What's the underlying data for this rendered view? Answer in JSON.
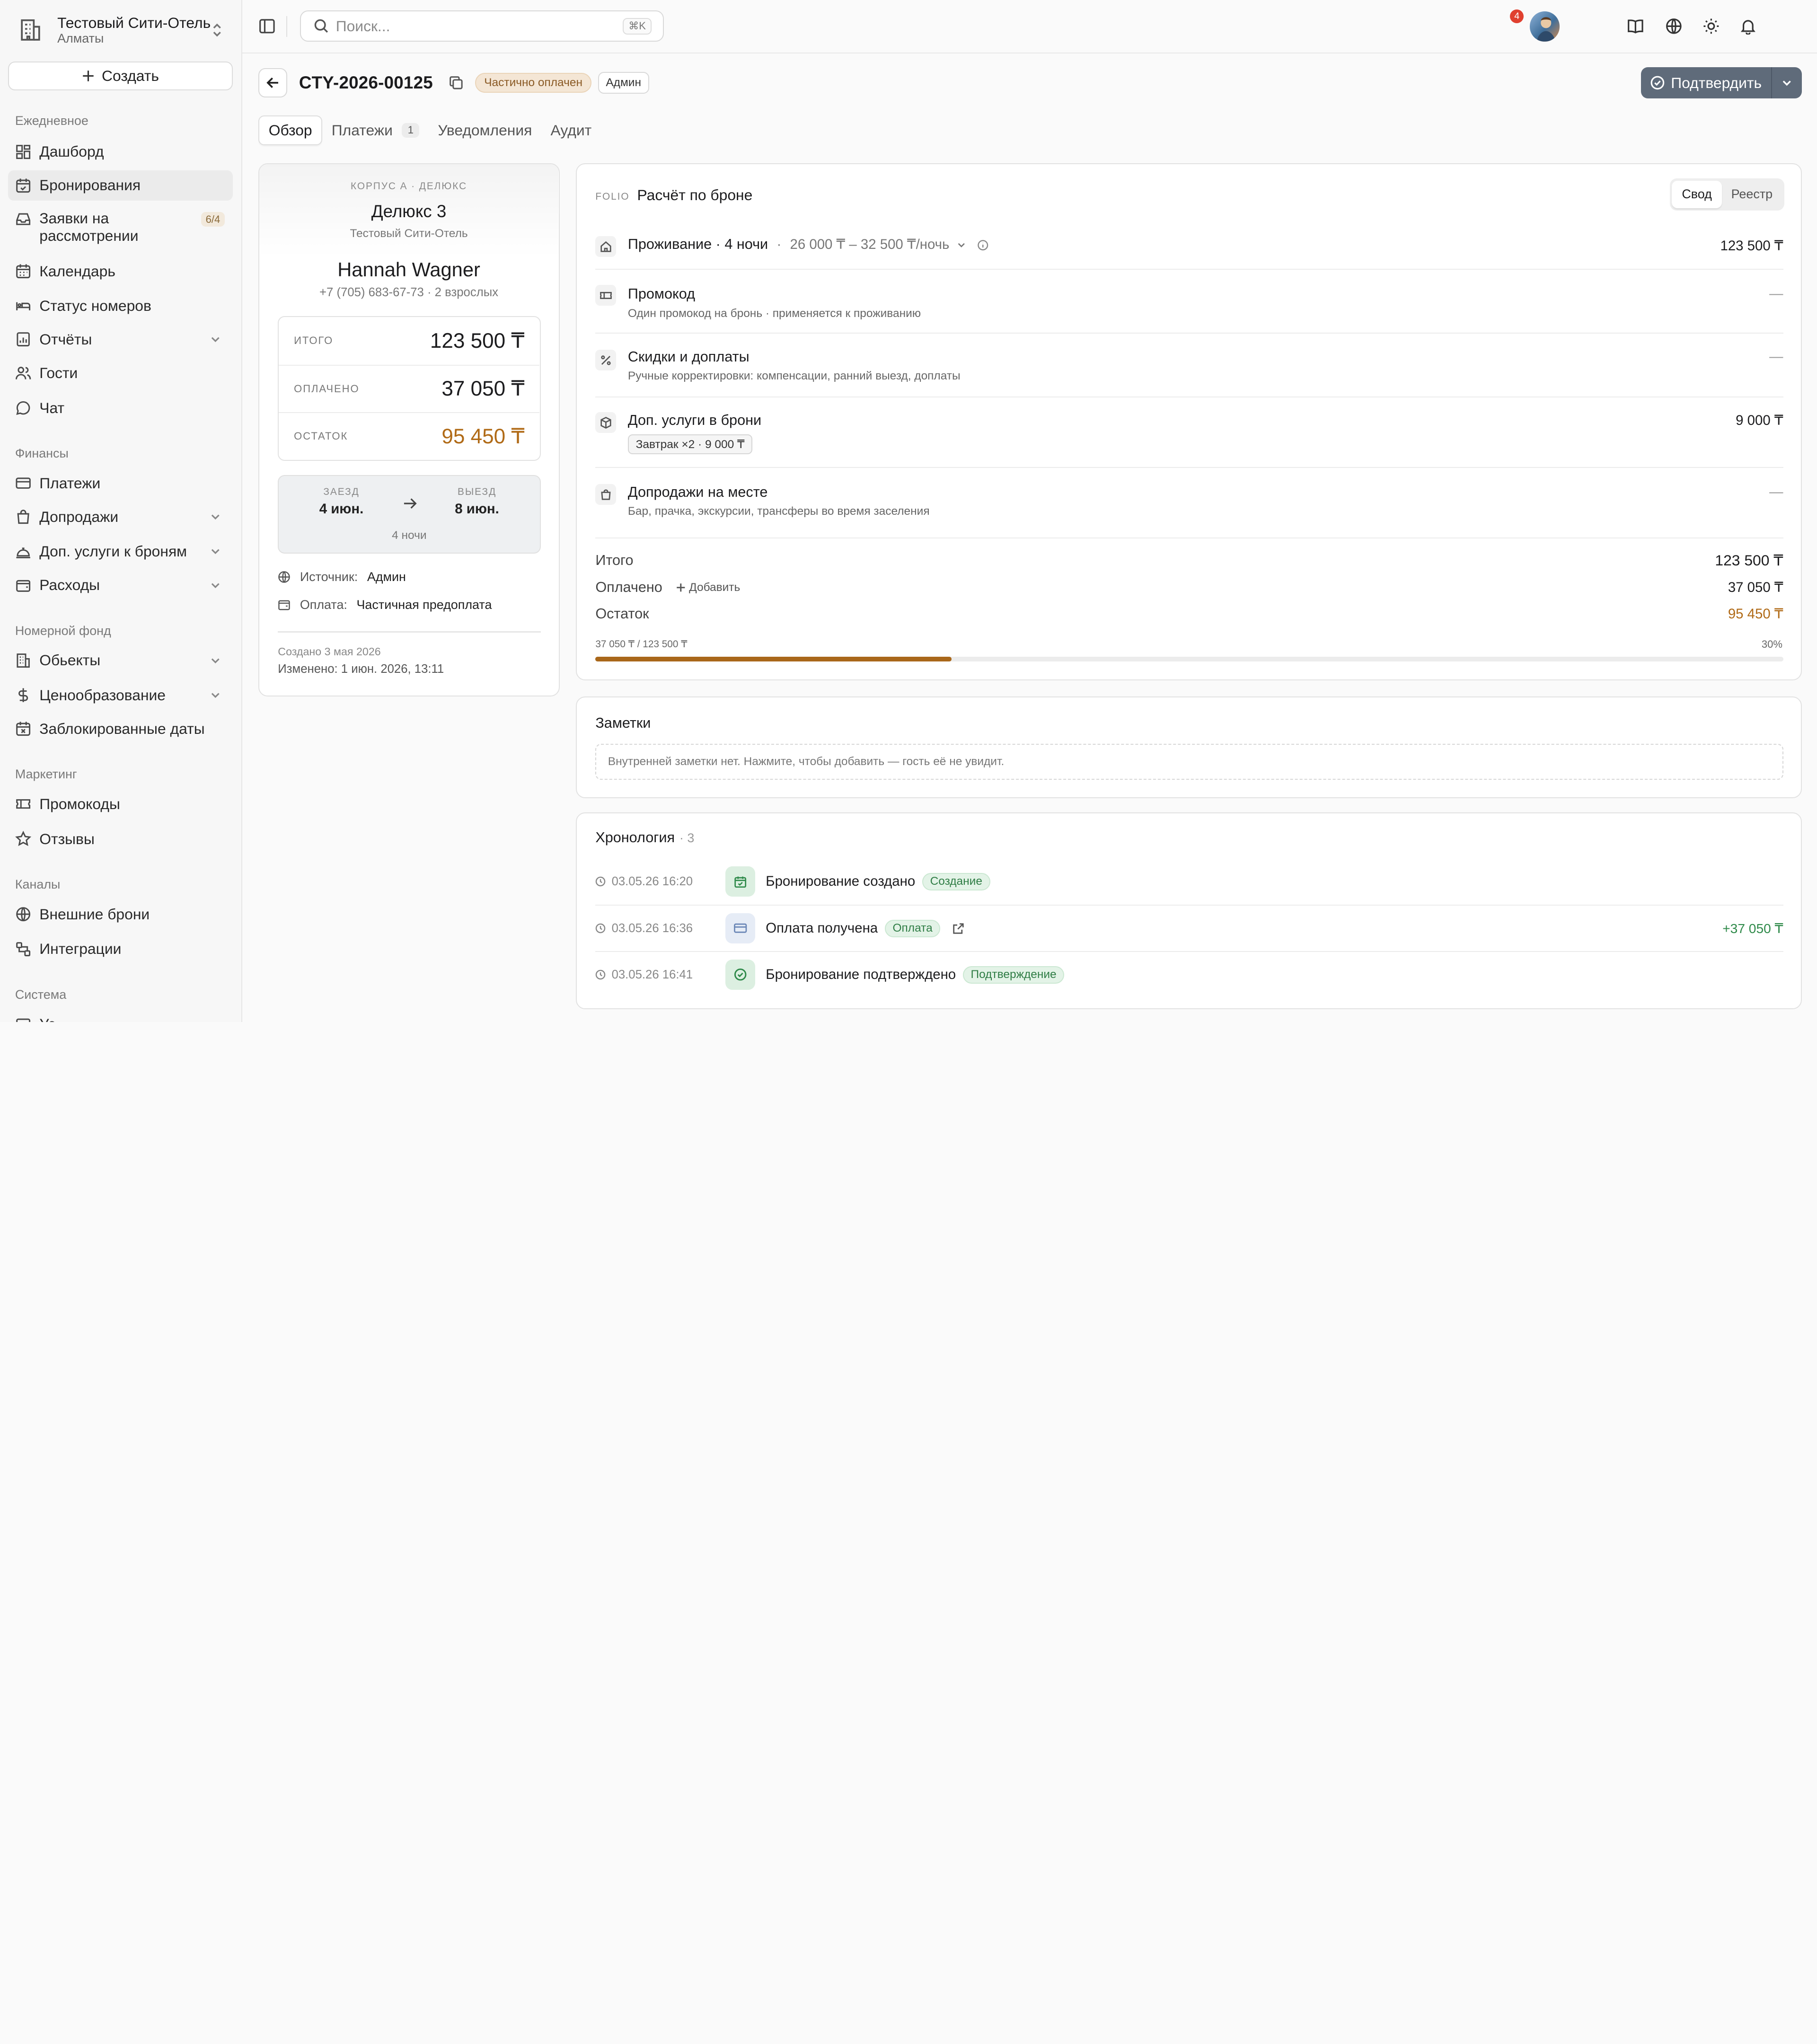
{
  "sidebar": {
    "hotel_name": "Тестовый Сити-Отель",
    "hotel_city": "Алматы",
    "create_label": "Создать",
    "sections": {
      "daily": "Ежедневное",
      "finance": "Финансы",
      "rooms": "Номерной фонд",
      "marketing": "Маркетинг",
      "channels": "Каналы",
      "system": "Система"
    },
    "items": {
      "dashboard": "Дашборд",
      "bookings": "Бронирования",
      "requests": "Заявки на рассмотрении",
      "requests_badge": "6/4",
      "calendar": "Календарь",
      "room_status": "Статус номеров",
      "reports": "Отчёты",
      "guests": "Гости",
      "chat": "Чат",
      "payments": "Платежи",
      "upsells": "Допродажи",
      "addons": "Доп. услуги к броням",
      "expenses": "Расходы",
      "properties": "Обьекты",
      "pricing": "Ценообразование",
      "blocked_dates": "Заблокированные даты",
      "promocodes": "Промокоды",
      "reviews": "Отзывы",
      "external_bookings": "Внешние брони",
      "integrations": "Интеграции",
      "system_first": "Ус"
    }
  },
  "topbar": {
    "search_placeholder": "Поиск...",
    "shortcut": "⌘K",
    "notifications_count": "4"
  },
  "booking": {
    "id": "CTY-2026-00125",
    "status": "Частично оплачен",
    "source_badge": "Админ",
    "confirm_label": "Подтвердить"
  },
  "tabs": {
    "overview": "Обзор",
    "payments": "Платежи",
    "payments_count": "1",
    "notifications": "Уведомления",
    "audit": "Аудит"
  },
  "summary": {
    "room_category": "КОРПУС А · ДЕЛЮКС",
    "room_name": "Делюкс 3",
    "hotel": "Тестовый Сити-Отель",
    "guest_name": "Hannah Wagner",
    "guest_info": "+7 (705) 683-67-73 · 2 взрослых",
    "total_label": "ИТОГО",
    "total_value": "123 500 ₸",
    "paid_label": "ОПЛАЧЕНО",
    "paid_value": "37 050 ₸",
    "balance_label": "ОСТАТОК",
    "balance_value": "95 450 ₸",
    "checkin_label": "ЗАЕЗД",
    "checkin_value": "4 июн.",
    "checkout_label": "ВЫЕЗД",
    "checkout_value": "8 июн.",
    "nights": "4 ночи",
    "source_label": "Источник:",
    "source_value": "Админ",
    "payment_label": "Оплата:",
    "payment_value": "Частичная предоплата",
    "created": "Создано 3 мая 2026",
    "changed": "Изменено: 1 июн. 2026, 13:11"
  },
  "folio": {
    "eyebrow": "FOLIO",
    "title": "Расчёт по броне",
    "view_summary": "Свод",
    "view_register": "Реестр",
    "stay_title": "Проживание · 4 ночи",
    "stay_sep": "·",
    "stay_rate": "26 000 ₸ – 32 500 ₸/ночь",
    "stay_amount": "123 500 ₸",
    "promo_title": "Промокод",
    "promo_desc": "Один промокод на бронь · применяется к проживанию",
    "promo_amount": "—",
    "adj_title": "Скидки и доплаты",
    "adj_desc": "Ручные корректировки: компенсации, ранний выезд, доплаты",
    "adj_amount": "—",
    "services_title": "Доп. услуги в брони",
    "services_chip": "Завтрак ×2 · 9 000 ₸",
    "services_amount": "9 000 ₸",
    "onsite_title": "Допродажи на месте",
    "onsite_desc": "Бар, прачка, экскурсии, трансферы во время заселения",
    "onsite_amount": "—",
    "total_label": "Итого",
    "total_value": "123 500 ₸",
    "paid_label": "Оплачено",
    "add_label": "Добавить",
    "paid_value": "37 050 ₸",
    "balance_label": "Остаток",
    "balance_value": "95 450 ₸",
    "progress_text": "37 050 ₸ / 123 500 ₸",
    "progress_percent": "30%",
    "progress_fraction": 0.3
  },
  "notes": {
    "title": "Заметки",
    "placeholder": "Внутренней заметки нет. Нажмите, чтобы добавить — гость её не увидит."
  },
  "timeline": {
    "title": "Хронология",
    "count": "· 3",
    "events": [
      {
        "time": "03.05.26 16:20",
        "text": "Бронирование создано",
        "tag": "Создание",
        "amount": ""
      },
      {
        "time": "03.05.26 16:36",
        "text": "Оплата получена",
        "tag": "Оплата",
        "amount": "+37 050 ₸"
      },
      {
        "time": "03.05.26 16:41",
        "text": "Бронирование подтверждено",
        "tag": "Подтверждение",
        "amount": ""
      }
    ]
  },
  "colors": {
    "accent_orange": "#b06a16",
    "success_green": "#2f8a4a",
    "confirm_button": "#5f6b7a"
  }
}
